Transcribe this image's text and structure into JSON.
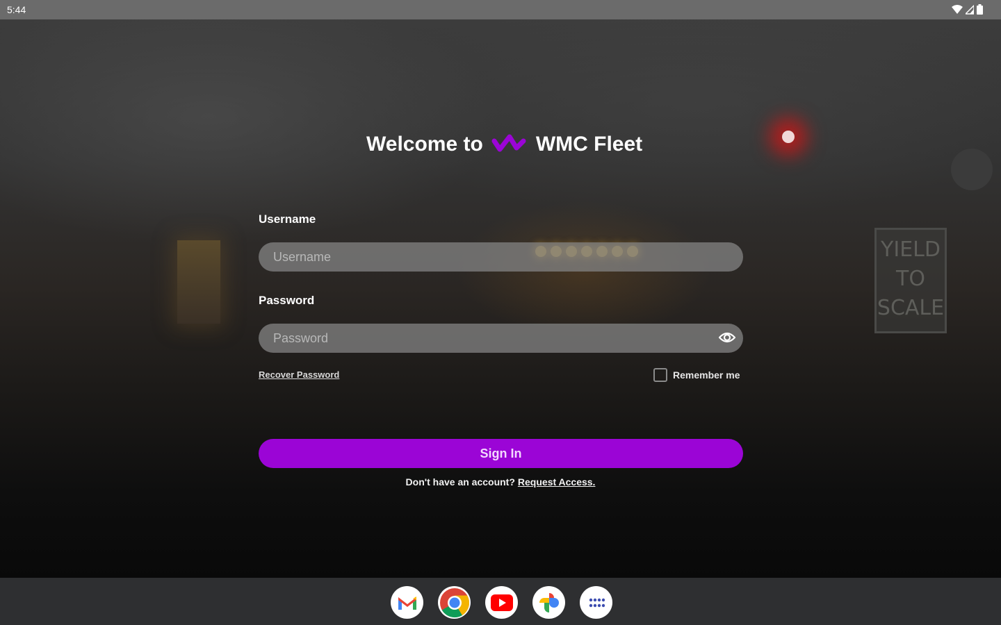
{
  "status_bar": {
    "time": "5:44",
    "icons": [
      "wifi-icon",
      "signal-icon",
      "battery-icon"
    ]
  },
  "background": {
    "sign_text": "YIELD TO SCALE"
  },
  "header": {
    "welcome_text": "Welcome to",
    "app_name": "WMC Fleet",
    "logo_icon": "wmc-logo-icon"
  },
  "form": {
    "username_label": "Username",
    "username_placeholder": "Username",
    "username_value": "",
    "password_label": "Password",
    "password_placeholder": "Password",
    "password_value": "",
    "recover_password": "Recover Password",
    "remember_me": "Remember me",
    "remember_me_checked": false,
    "sign_in": "Sign In",
    "no_account_text": "Don't have an account?",
    "request_access": "Request Access."
  },
  "dock": {
    "apps": [
      "gmail-icon",
      "chrome-icon",
      "youtube-icon",
      "photos-icon",
      "app-drawer-icon"
    ]
  },
  "colors": {
    "accent": "#9b05d6",
    "status_bar": "#6b6b6b",
    "dock": "#2e2f31"
  }
}
